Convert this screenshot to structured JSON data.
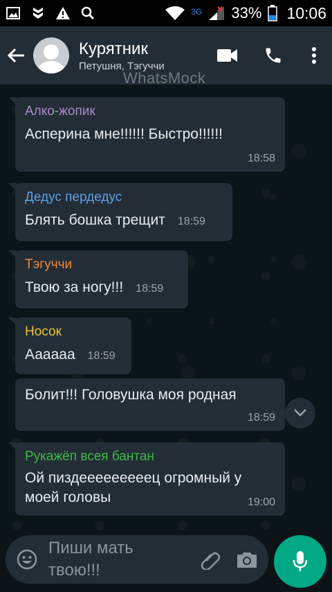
{
  "status_bar": {
    "network_type": "3G",
    "battery_percent": "33%",
    "time": "10:06",
    "icons": [
      "image-icon",
      "shield-icon",
      "warning-icon",
      "search-icon",
      "wifi-icon",
      "signal-icon",
      "battery-icon"
    ]
  },
  "header": {
    "title": "Курятник",
    "members": "Петушня, Тэгуччи",
    "watermark": "WhatsMock",
    "icons": [
      "back-arrow-icon",
      "avatar",
      "video-call-icon",
      "phone-icon",
      "more-vert-icon"
    ]
  },
  "messages": [
    {
      "sender": "Алко-жопик",
      "sender_color": "#a98ac9",
      "text": "Асперина мне!!!!!! Быстро!!!!!!",
      "time": "18:58"
    },
    {
      "sender": "Дедус пердедус",
      "sender_color": "#5e9fe8",
      "text": "Блять бошка трещит",
      "time": "18:59"
    },
    {
      "sender": "Тэгуччи",
      "sender_color": "#f2893b",
      "text": "Твою за ногу!!!",
      "time": "18:59"
    },
    {
      "sender": "Носок",
      "sender_color": "#e9c33c",
      "text": "Аааааа",
      "time": "18:59"
    },
    {
      "sender": "",
      "sender_color": "",
      "text": "Болит!!! Головушка моя родная",
      "time": "18:59"
    },
    {
      "sender": "Рукажёп всея бантан",
      "sender_color": "#3fb845",
      "text": "Ой пиздееееееееец огромный у моей головы",
      "time": "19:00"
    }
  ],
  "composer": {
    "placeholder": "Пиши мать твою!!!",
    "icons": [
      "emoji-icon",
      "attach-icon",
      "camera-icon",
      "mic-icon",
      "chevron-down-icon"
    ]
  },
  "colors": {
    "app_bar": "#232d36",
    "bubble": "#232d36",
    "chat_background": "#0b1418",
    "accent": "#00a884"
  }
}
